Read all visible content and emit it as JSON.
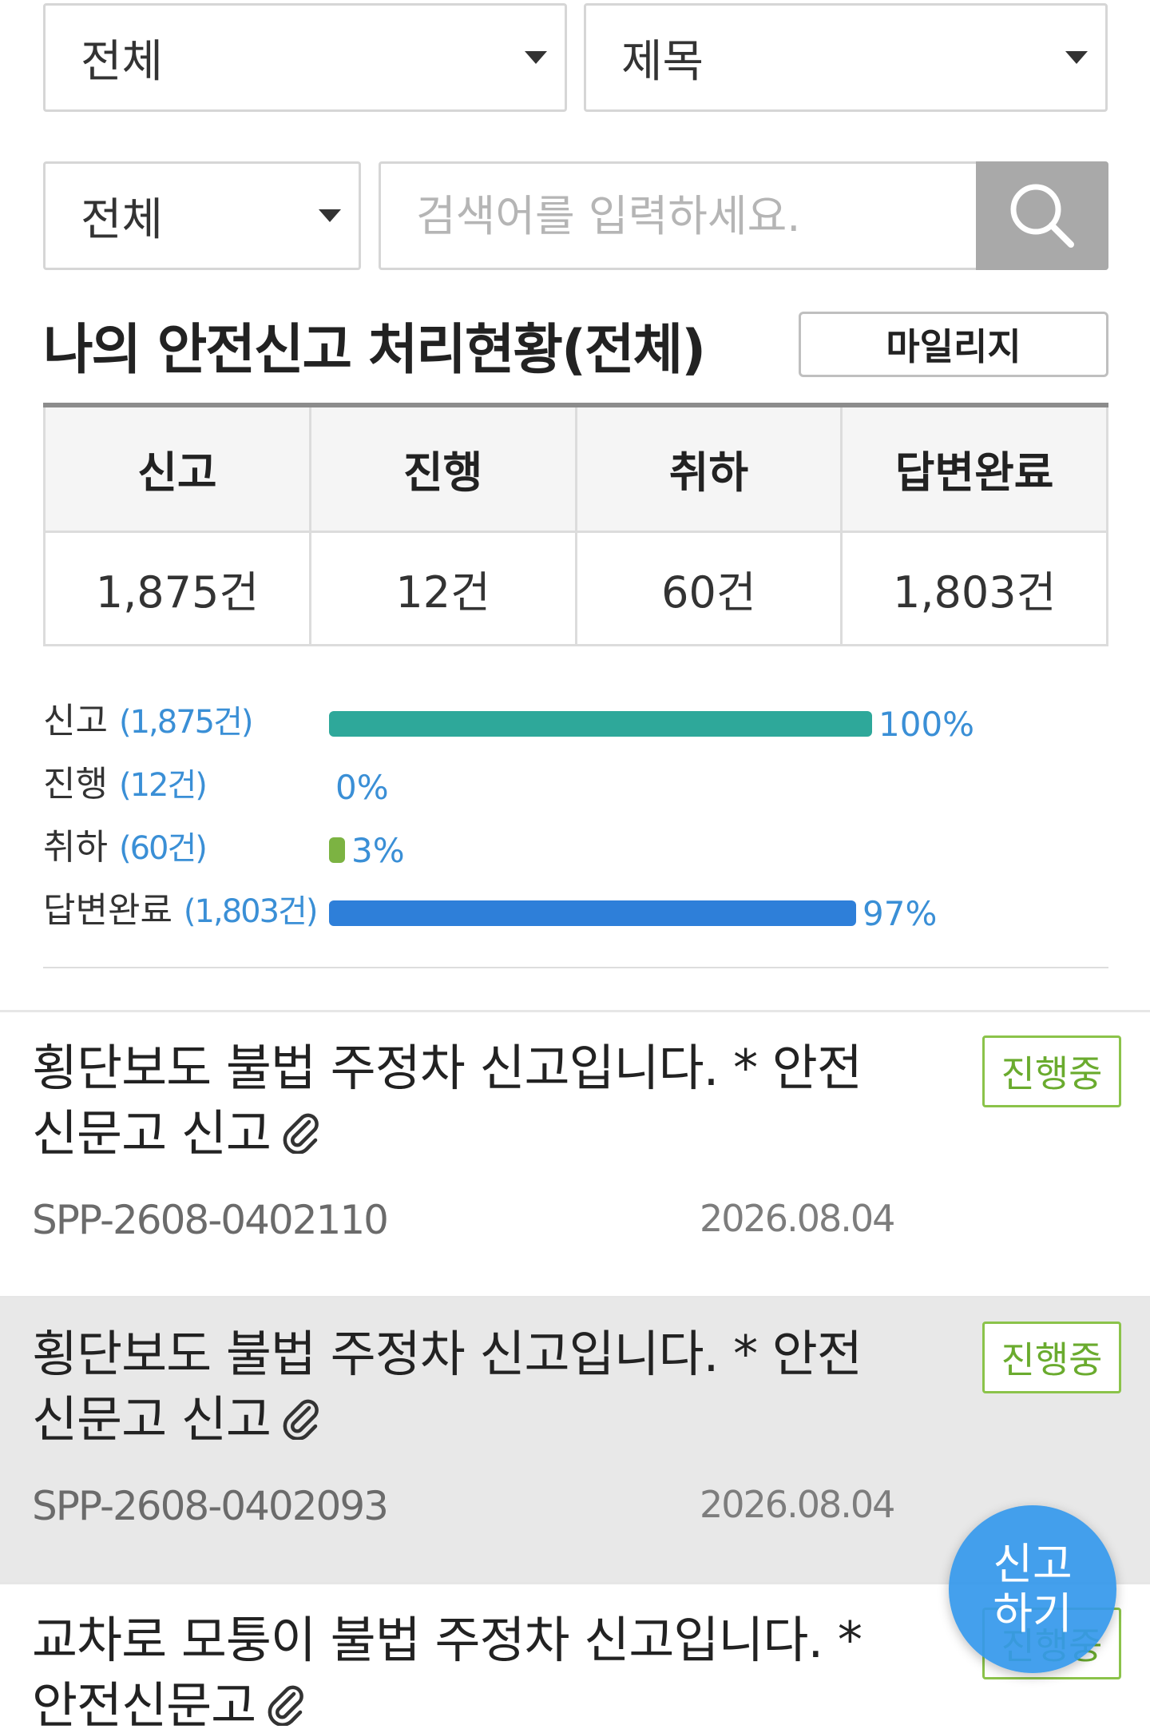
{
  "filters": {
    "area": "전체",
    "field": "제목",
    "status": "전체",
    "search_placeholder": "검색어를 입력하세요."
  },
  "summary": {
    "title": "나의 안전신고 처리현황(전체)",
    "mileage_label": "마일리지",
    "headers": [
      "신고",
      "진행",
      "취하",
      "답변완료"
    ],
    "counts": [
      "1,875건",
      "12건",
      "60건",
      "1,803건"
    ]
  },
  "progress": [
    {
      "label": "신고",
      "count": "(1,875건)",
      "percent": 100,
      "percent_label": "100%",
      "color": "#2ea89a"
    },
    {
      "label": "진행",
      "count": "(12건)",
      "percent": 0,
      "percent_label": "0%",
      "color": "#2ea89a"
    },
    {
      "label": "취하",
      "count": "(60건)",
      "percent": 3,
      "percent_label": "3%",
      "color": "#7cb342"
    },
    {
      "label": "답변완료",
      "count": "(1,803건)",
      "percent": 97,
      "percent_label": "97%",
      "color": "#2e7fd9"
    }
  ],
  "items": [
    {
      "title": "횡단보도 불법 주정차 신고입니다. * 안전신문고 신고",
      "id": "SPP-2608-0402110",
      "date": "2026.08.04",
      "status": "진행중"
    },
    {
      "title": "횡단보도 불법 주정차 신고입니다. * 안전신문고 신고",
      "id": "SPP-2608-0402093",
      "date": "2026.08.04",
      "status": "진행중"
    },
    {
      "title": "교차로 모퉁이 불법 주정차 신고입니다. * 안전신문고",
      "id": "",
      "date": "",
      "status": "진행중"
    }
  ],
  "fab": {
    "line1": "신고",
    "line2": "하기"
  },
  "colors": {
    "accent": "#3498eb",
    "badge": "#8bc34a"
  },
  "icons": {
    "search": "search-icon",
    "attachment": "paperclip-icon",
    "dropdown": "caret-down-icon"
  }
}
